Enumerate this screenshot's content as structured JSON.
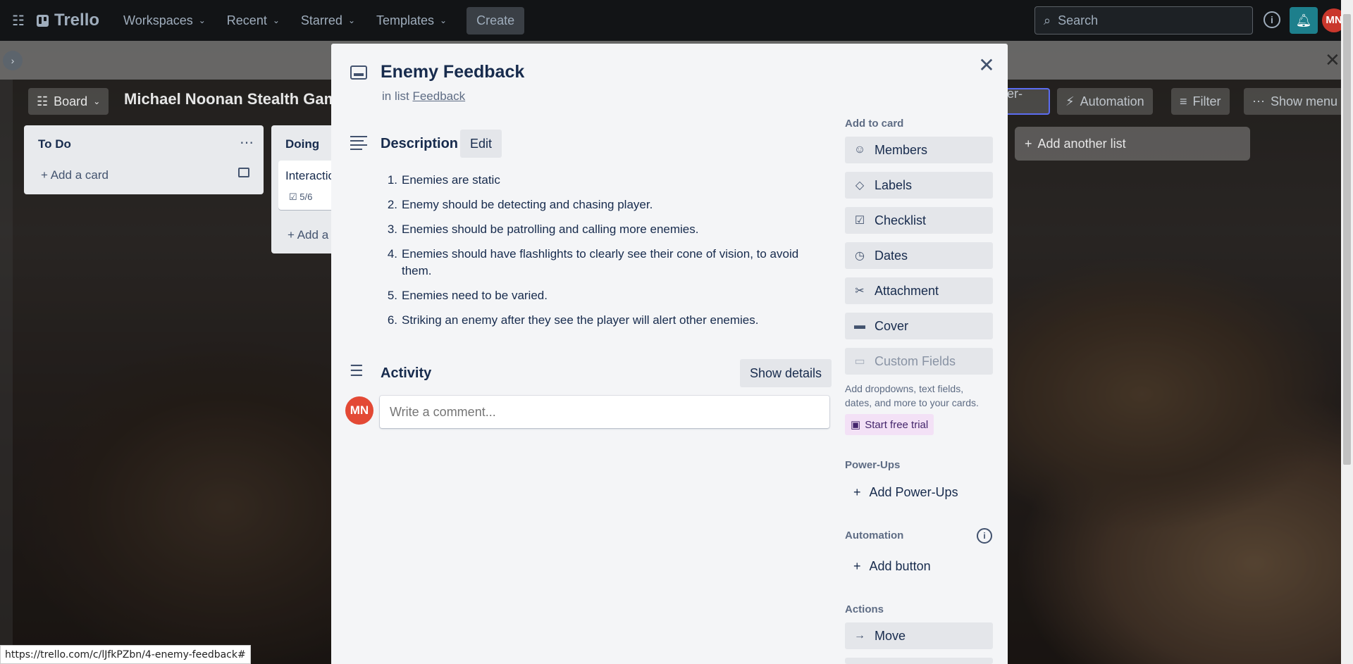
{
  "nav": {
    "brand": "Trello",
    "items": [
      "Workspaces",
      "Recent",
      "Starred",
      "Templates"
    ],
    "create_label": "Create",
    "search_placeholder": "Search",
    "avatar_initials": "MN"
  },
  "board": {
    "view_label": "Board",
    "title": "Michael Noonan Stealth Game",
    "powerups_label": "Power-Ups",
    "automation_label": "Automation",
    "filter_label": "Filter",
    "show_menu_label": "Show menu",
    "add_list_label": "Add another list",
    "lists": [
      {
        "title": "To Do",
        "add_card": "Add a card"
      },
      {
        "title": "Doing",
        "card_title": "Interaction",
        "card_checklist": "5/6",
        "add_card": "Add a card"
      }
    ]
  },
  "modal": {
    "title": "Enemy Feedback",
    "in_list_prefix": "in list",
    "list_name": "Feedback",
    "description_heading": "Description",
    "edit_label": "Edit",
    "description_items": [
      "Enemies are static",
      "Enemy should be detecting and chasing player.",
      "Enemies should be patrolling and calling more enemies.",
      "Enemies should have flashlights to clearly see their cone of vision, to avoid them.",
      "Enemies need to be varied.",
      "Striking an enemy after they see the player will alert other enemies."
    ],
    "activity_heading": "Activity",
    "show_details_label": "Show details",
    "comment_placeholder": "Write a comment...",
    "user_initials": "MN",
    "sidebar": {
      "add_to_card_label": "Add to card",
      "add_to_card": [
        "Members",
        "Labels",
        "Checklist",
        "Dates",
        "Attachment",
        "Cover",
        "Custom Fields"
      ],
      "custom_fields_note": "Add dropdowns, text fields, dates, and more to your cards.",
      "trial_label": "Start free trial",
      "powerups_label": "Power-Ups",
      "add_powerups": "Add Power-Ups",
      "automation_label": "Automation",
      "add_button": "Add button",
      "actions_label": "Actions",
      "move_label": "Move"
    }
  },
  "status_url": "https://trello.com/c/lJfkPZbn/4-enemy-feedback#"
}
